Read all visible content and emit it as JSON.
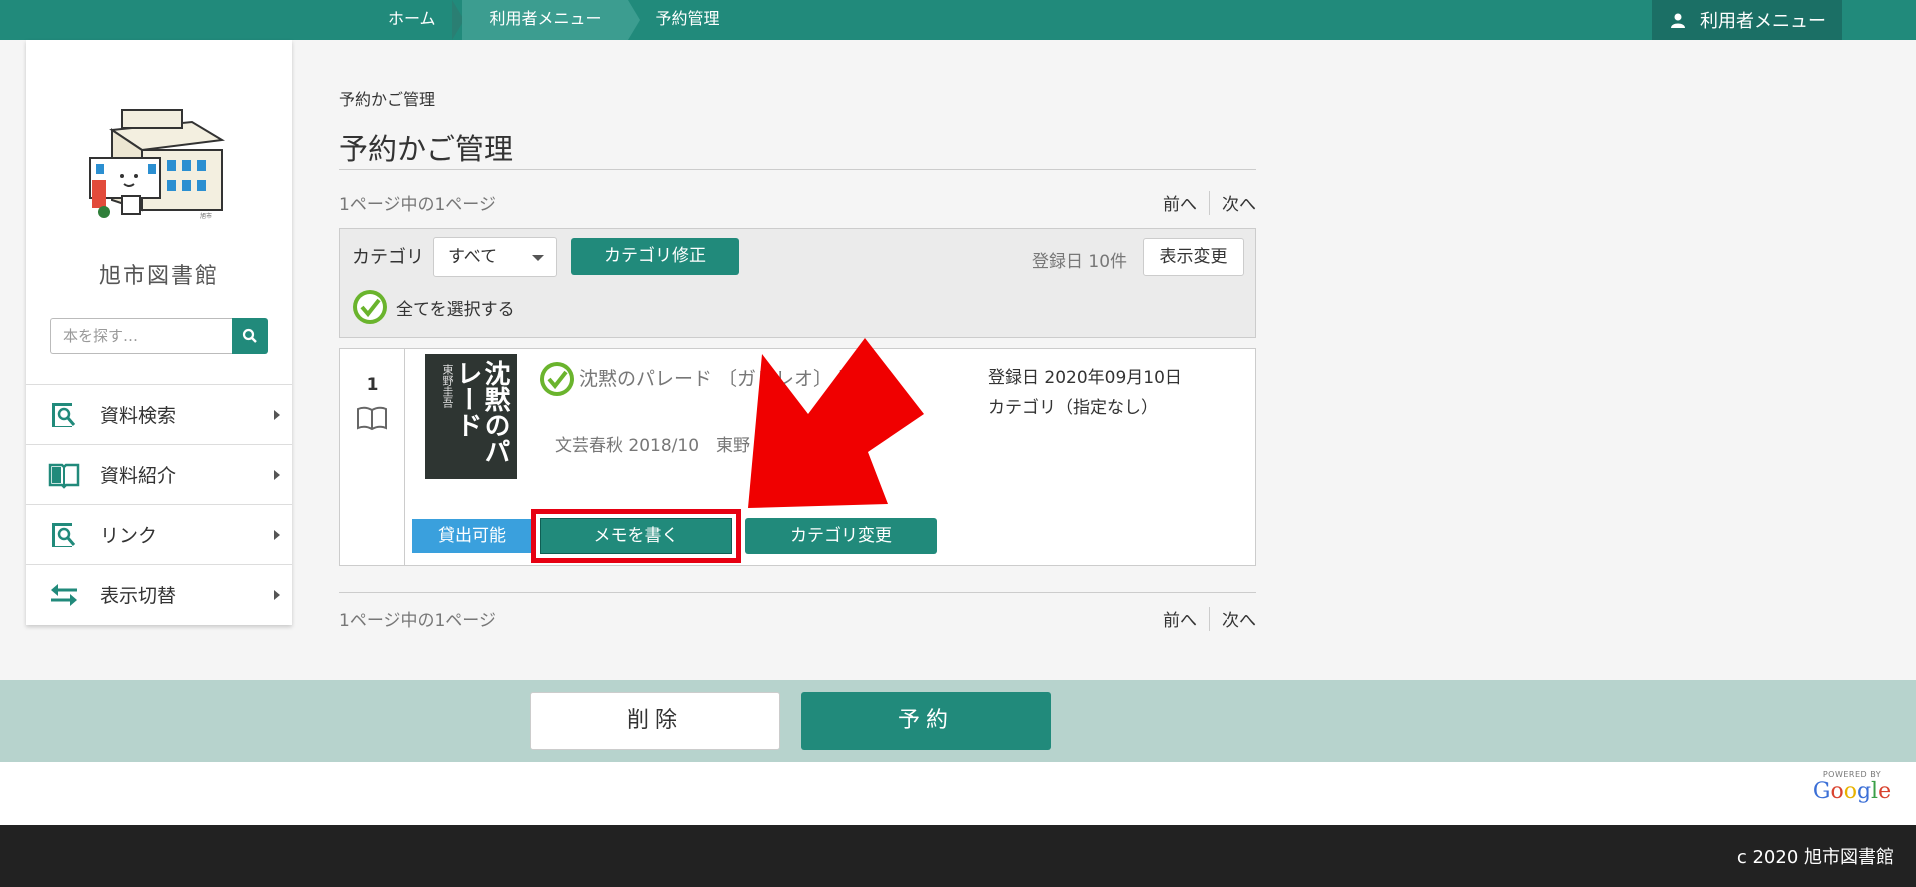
{
  "topbar": {
    "breadcrumbs": [
      "ホーム",
      "利用者メニュー",
      "予約管理"
    ],
    "user_menu": "利用者メニュー"
  },
  "sidebar": {
    "library_name": "旭市図書館",
    "search_placeholder": "本を探す…",
    "items": [
      {
        "label": "資料検索",
        "icon": "search-book-icon"
      },
      {
        "label": "資料紹介",
        "icon": "open-book-icon"
      },
      {
        "label": "リンク",
        "icon": "link-search-icon"
      },
      {
        "label": "表示切替",
        "icon": "swap-arrows-icon"
      }
    ]
  },
  "main": {
    "breadcrumb_title": "予約かご管理",
    "title": "予約かご管理",
    "page_info": "1ページ中の1ページ",
    "pager_prev": "前へ",
    "pager_next": "次へ",
    "toolbar": {
      "category_label": "カテゴリ",
      "category_value": "すべて",
      "category_fix_button": "カテゴリ修正",
      "sort_count": "登録日 10件",
      "display_change_button": "表示変更",
      "select_all": "全てを選択する"
    },
    "items": [
      {
        "index": "1",
        "cover_title": "沈黙のパレード",
        "cover_author": "東野圭吾",
        "title": "沈黙のパレード 〔ガリレオ〕 図書",
        "publisher_line": "文芸春秋 2018/10　東野",
        "registered": "登録日 2020年09月10日",
        "category": "カテゴリ（指定なし）",
        "status": "貸出可能",
        "memo_button": "メモを書く",
        "category_change_button": "カテゴリ変更"
      }
    ]
  },
  "actions": {
    "delete": "削除",
    "reserve": "予約"
  },
  "google": {
    "powered": "POWERED BY",
    "logo": "Google"
  },
  "footer": {
    "copyright": "c 2020 旭市図書館"
  },
  "colors": {
    "brand": "#218a7b",
    "status_blue": "#3aa0dd",
    "highlight_red": "#e60012",
    "action_bar": "#b7d3cd"
  }
}
